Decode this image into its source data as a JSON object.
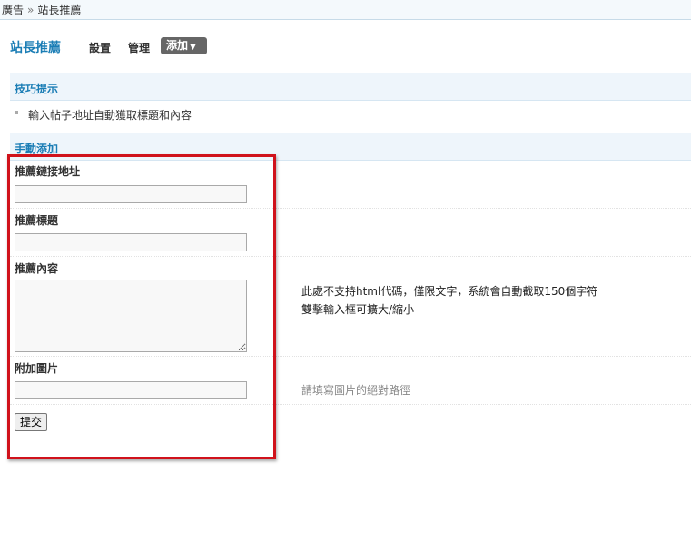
{
  "breadcrumb": {
    "items": [
      "廣告",
      "站長推薦"
    ],
    "separator": "»"
  },
  "header": {
    "title": "站長推薦",
    "nav": [
      {
        "label": "設置"
      },
      {
        "label": "管理"
      },
      {
        "label": "添加",
        "active": true
      }
    ],
    "dropdown_caret": "▼"
  },
  "tips": {
    "title": "技巧提示",
    "items": [
      "輸入帖子地址自動獲取標題和內容"
    ]
  },
  "form": {
    "section_title": "手動添加",
    "fields": [
      {
        "label": "推薦鏈接地址",
        "value": "",
        "hint": ""
      },
      {
        "label": "推薦標題",
        "value": "",
        "hint": ""
      },
      {
        "label": "推薦內容",
        "value": "",
        "hint_lines": [
          "此處不支持html代碼，僅限文字，系統會自動截取150個字符",
          "雙擊輸入框可擴大/縮小"
        ]
      },
      {
        "label": "附加圖片",
        "value": "",
        "hint": "請填寫圖片的絕對路徑"
      }
    ],
    "submit_label": "提交"
  },
  "colors": {
    "accent": "#1a7db5",
    "band_background": "#eef5fb",
    "active_tab": "#666666",
    "highlight": "#d0121b"
  }
}
